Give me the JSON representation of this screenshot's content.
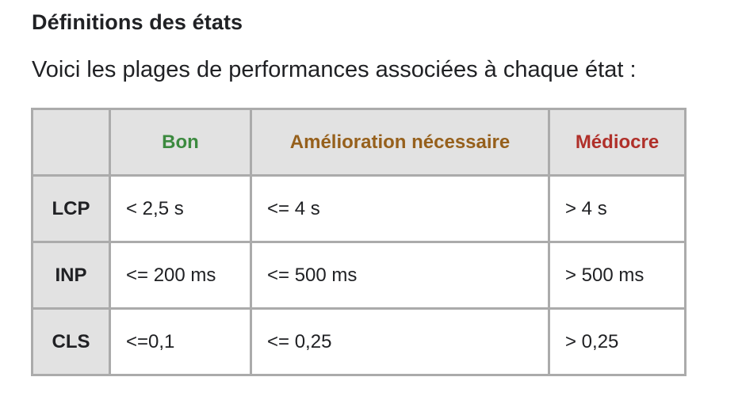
{
  "section": {
    "title": "Définitions des états",
    "intro": "Voici les plages de performances associées à chaque état :"
  },
  "table": {
    "headers": [
      {
        "label": "",
        "color": ""
      },
      {
        "label": "Bon",
        "color": "#3c8a3f"
      },
      {
        "label": "Amélioration nécessaire",
        "color": "#96601c"
      },
      {
        "label": "Médiocre",
        "color": "#b0302a"
      }
    ],
    "rows": [
      {
        "metric": "LCP",
        "good": "< 2,5 s",
        "needs_improvement": "<= 4 s",
        "poor": "> 4 s"
      },
      {
        "metric": "INP",
        "good": "<= 200 ms",
        "needs_improvement": "<= 500 ms",
        "poor": "> 500 ms"
      },
      {
        "metric": "CLS",
        "good": "<=0,1",
        "needs_improvement": "<= 0,25",
        "poor": "> 0,25"
      }
    ]
  },
  "colors": {
    "text": "#202124",
    "header_background": "#e2e2e2",
    "border": "#ababab",
    "good": "#3c8a3f",
    "needs_improvement": "#96601c",
    "poor": "#b0302a"
  }
}
